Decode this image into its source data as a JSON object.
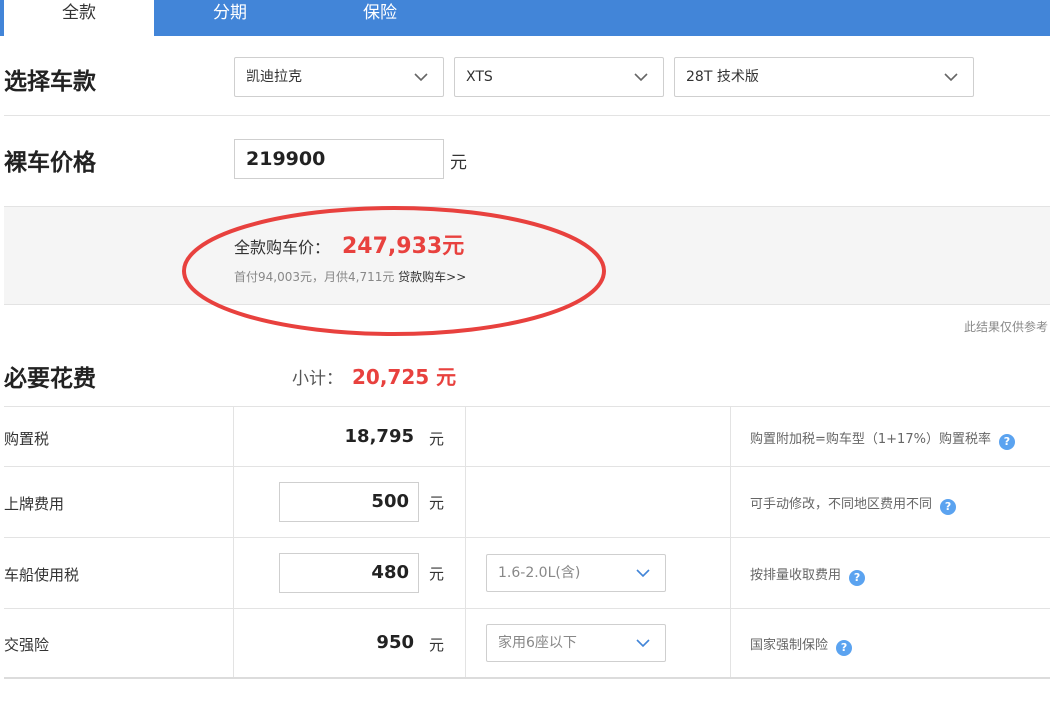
{
  "tabs": [
    "全款",
    "分期",
    "保险"
  ],
  "select_car": {
    "title": "选择车款",
    "brand": "凯迪拉克",
    "model": "XTS",
    "trim": "28T 技术版"
  },
  "bare_price": {
    "title": "裸车价格",
    "value": "219900",
    "unit": "元"
  },
  "summary": {
    "total_label": "全款购车价：",
    "total_value": "247,933元",
    "sub_text": "首付94,003元，月供4,711元",
    "loan_link": "贷款购车>>"
  },
  "disclaimer": "此结果仅供参考",
  "required": {
    "title": "必要花费",
    "subtotal_label": "小计：",
    "subtotal_value": "20,725 元",
    "rows": [
      {
        "label": "购置税",
        "value": "18,795",
        "unit": "元",
        "note": "购置附加税=购车型（1+17%）购置税率"
      },
      {
        "label": "上牌费用",
        "value": "500",
        "unit": "元",
        "note": "可手动修改，不同地区费用不同"
      },
      {
        "label": "车船使用税",
        "value": "480",
        "unit": "元",
        "option": "1.6-2.0L(含)",
        "note": "按排量收取费用"
      },
      {
        "label": "交强险",
        "value": "950",
        "unit": "元",
        "option": "家用6座以下",
        "note": "国家强制保险"
      }
    ]
  },
  "colors": {
    "tab_bar": "#4285d8",
    "accent_red": "#e8413e",
    "help_blue": "#5ba3f0",
    "annotation": "#e8413e"
  },
  "icons": {
    "dropdown": "chevron-down-icon",
    "help": "question-mark-icon"
  }
}
